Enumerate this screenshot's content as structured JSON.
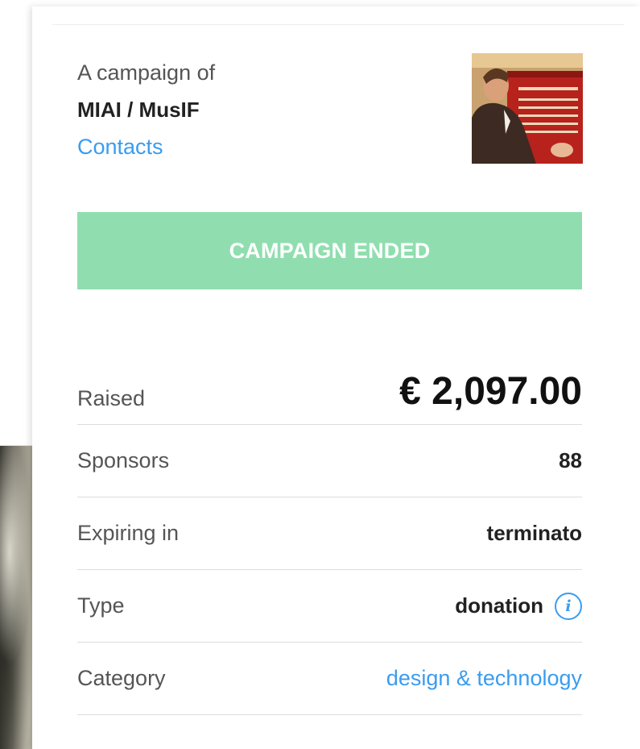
{
  "owner": {
    "label": "A campaign of",
    "name": "MIAI / MusIF",
    "contacts_link": "Contacts"
  },
  "status_button": {
    "label": "CAMPAIGN ENDED",
    "color": "#90deaf"
  },
  "stats": {
    "raised": {
      "label": "Raised",
      "value": "€ 2,097.00"
    },
    "sponsors": {
      "label": "Sponsors",
      "value": "88"
    },
    "expiring": {
      "label": "Expiring in",
      "value": "terminato"
    },
    "type": {
      "label": "Type",
      "value": "donation",
      "icon": "info-icon"
    },
    "category": {
      "label": "Category",
      "value": "design & technology"
    }
  },
  "colors": {
    "link": "#3a9cf0",
    "accent_green": "#90deaf",
    "text": "#222222",
    "muted": "#555555"
  }
}
